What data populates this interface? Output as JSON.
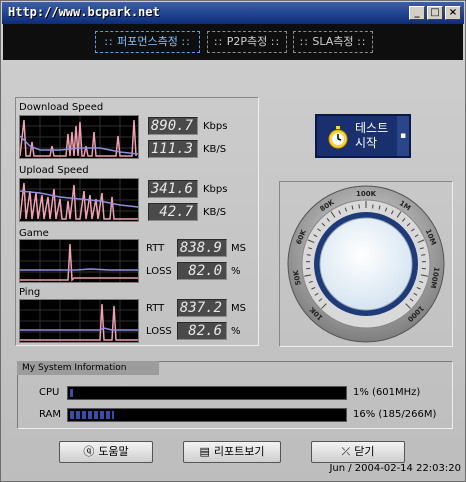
{
  "window": {
    "title": "Http://www.bcpark.net"
  },
  "titlebar": {
    "minimize_icon": "minimize-icon",
    "maximize_icon": "maximize-icon",
    "close_icon": "close-icon"
  },
  "tabs": [
    {
      "label": "퍼포먼스측정",
      "active": true
    },
    {
      "label": "P2P측정",
      "active": false
    },
    {
      "label": "SLA측정",
      "active": false
    }
  ],
  "metrics": {
    "download": {
      "label": "Download Speed",
      "value1": "890.7",
      "unit1": "Kbps",
      "value2": "111.3",
      "unit2": "KB/S"
    },
    "upload": {
      "label": "Upload Speed",
      "value1": "341.6",
      "unit1": "Kbps",
      "value2": "42.7",
      "unit2": "KB/S"
    },
    "game": {
      "label": "Game",
      "rtt_label": "RTT",
      "rtt": "838.9",
      "rtt_unit": "MS",
      "loss_label": "LOSS",
      "loss": "82.0",
      "loss_unit": "%"
    },
    "ping": {
      "label": "Ping",
      "rtt_label": "RTT",
      "rtt": "837.2",
      "rtt_unit": "MS",
      "loss_label": "LOSS",
      "loss": "82.6",
      "loss_unit": "%"
    }
  },
  "start_button": {
    "line1": "테스트",
    "line2": "시작",
    "icon": "stopwatch-icon"
  },
  "gauge": {
    "scale_labels": [
      "10K",
      "50K",
      "60K",
      "80K",
      "100K",
      "1M",
      "10M",
      "100M",
      "1000"
    ]
  },
  "system_info": {
    "header": "My System Information",
    "cpu": {
      "label": "CPU",
      "value": "1% (601MHz)",
      "percent": 1
    },
    "ram": {
      "label": "RAM",
      "value": "16% (185/266M)",
      "percent": 16
    }
  },
  "buttons": {
    "help": {
      "label": "도움말",
      "icon": "help-bubble-icon"
    },
    "report": {
      "label": "리포트보기",
      "icon": "report-icon"
    },
    "close": {
      "label": "닫기",
      "icon": "close-x-icon"
    }
  },
  "status": {
    "text": "Jun / 2004-02-14 22:03:20"
  },
  "colors": {
    "accent_blue": "#5a9ee6",
    "graph_pink": "#f0a0b0",
    "graph_blue": "#8f8fe0",
    "ram_fill": "#3a4ea8",
    "cpu_fill": "#3a4ea8"
  }
}
